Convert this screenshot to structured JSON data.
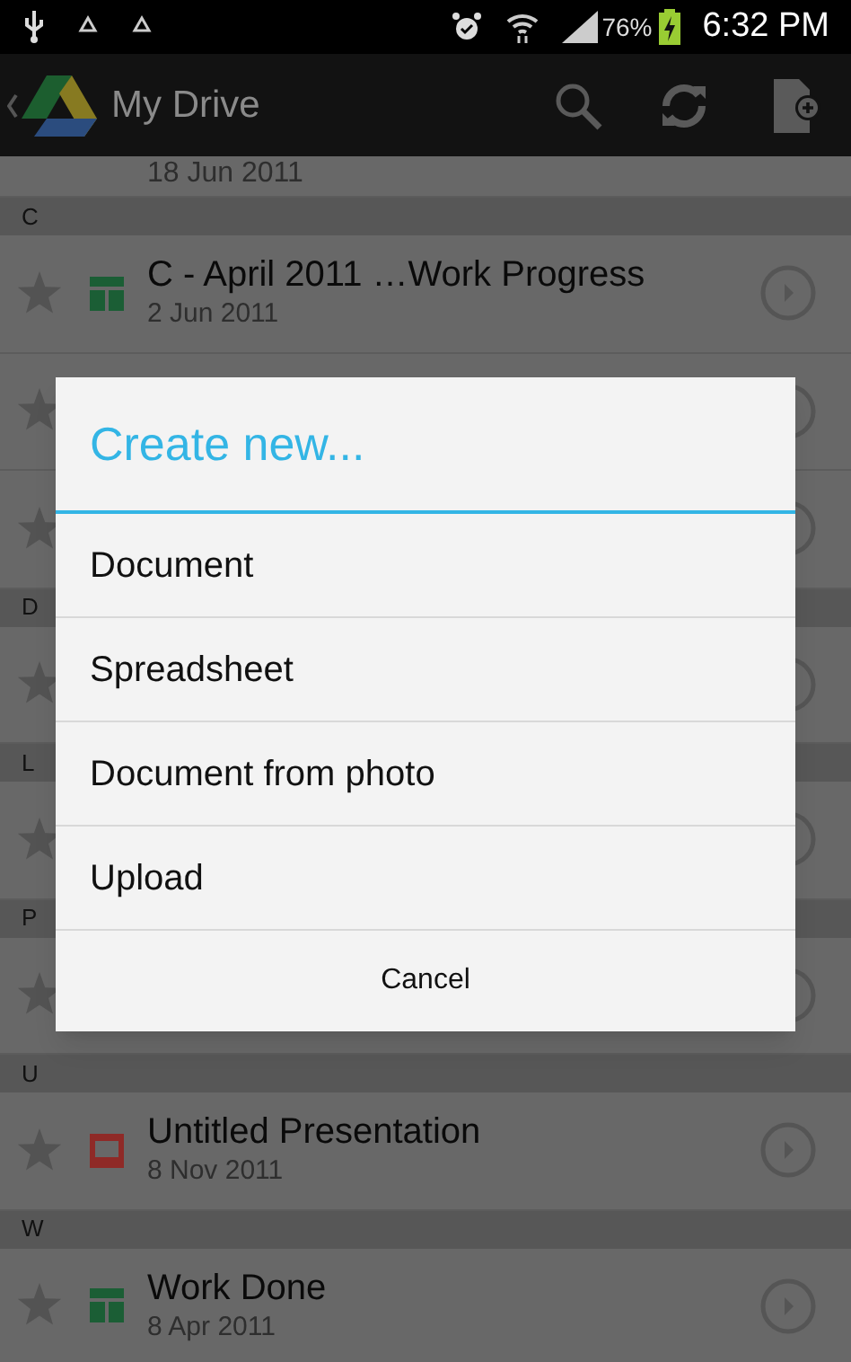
{
  "status_bar": {
    "battery": "76%",
    "time": "6:32 PM"
  },
  "action_bar": {
    "title": "My Drive"
  },
  "file_list": [
    {
      "kind": "cut_file",
      "date": "18 Jun 2011"
    },
    {
      "kind": "header",
      "letter": "C"
    },
    {
      "kind": "spreadsheet_file",
      "title": "C - April 2011 …Work Progress",
      "date": "2 Jun 2011",
      "starred": false
    },
    {
      "kind": "covered_file",
      "starred": false
    },
    {
      "kind": "covered_file",
      "starred": false
    },
    {
      "kind": "header",
      "letter": "D"
    },
    {
      "kind": "covered_file",
      "starred": false
    },
    {
      "kind": "header",
      "letter": "L"
    },
    {
      "kind": "covered_file",
      "starred": false
    },
    {
      "kind": "header",
      "letter": "P"
    },
    {
      "kind": "covered_file",
      "starred": false
    },
    {
      "kind": "header",
      "letter": "U"
    },
    {
      "kind": "presentation_file",
      "title": "Untitled Presentation",
      "date": "8 Nov 2011",
      "starred": false
    },
    {
      "kind": "header",
      "letter": "W"
    },
    {
      "kind": "spreadsheet_file",
      "title": "Work Done",
      "date": "8 Apr 2011",
      "starred": false
    }
  ],
  "dialog": {
    "title": "Create new...",
    "options": [
      "Document",
      "Spreadsheet",
      "Document from photo",
      "Upload"
    ],
    "cancel": "Cancel"
  }
}
